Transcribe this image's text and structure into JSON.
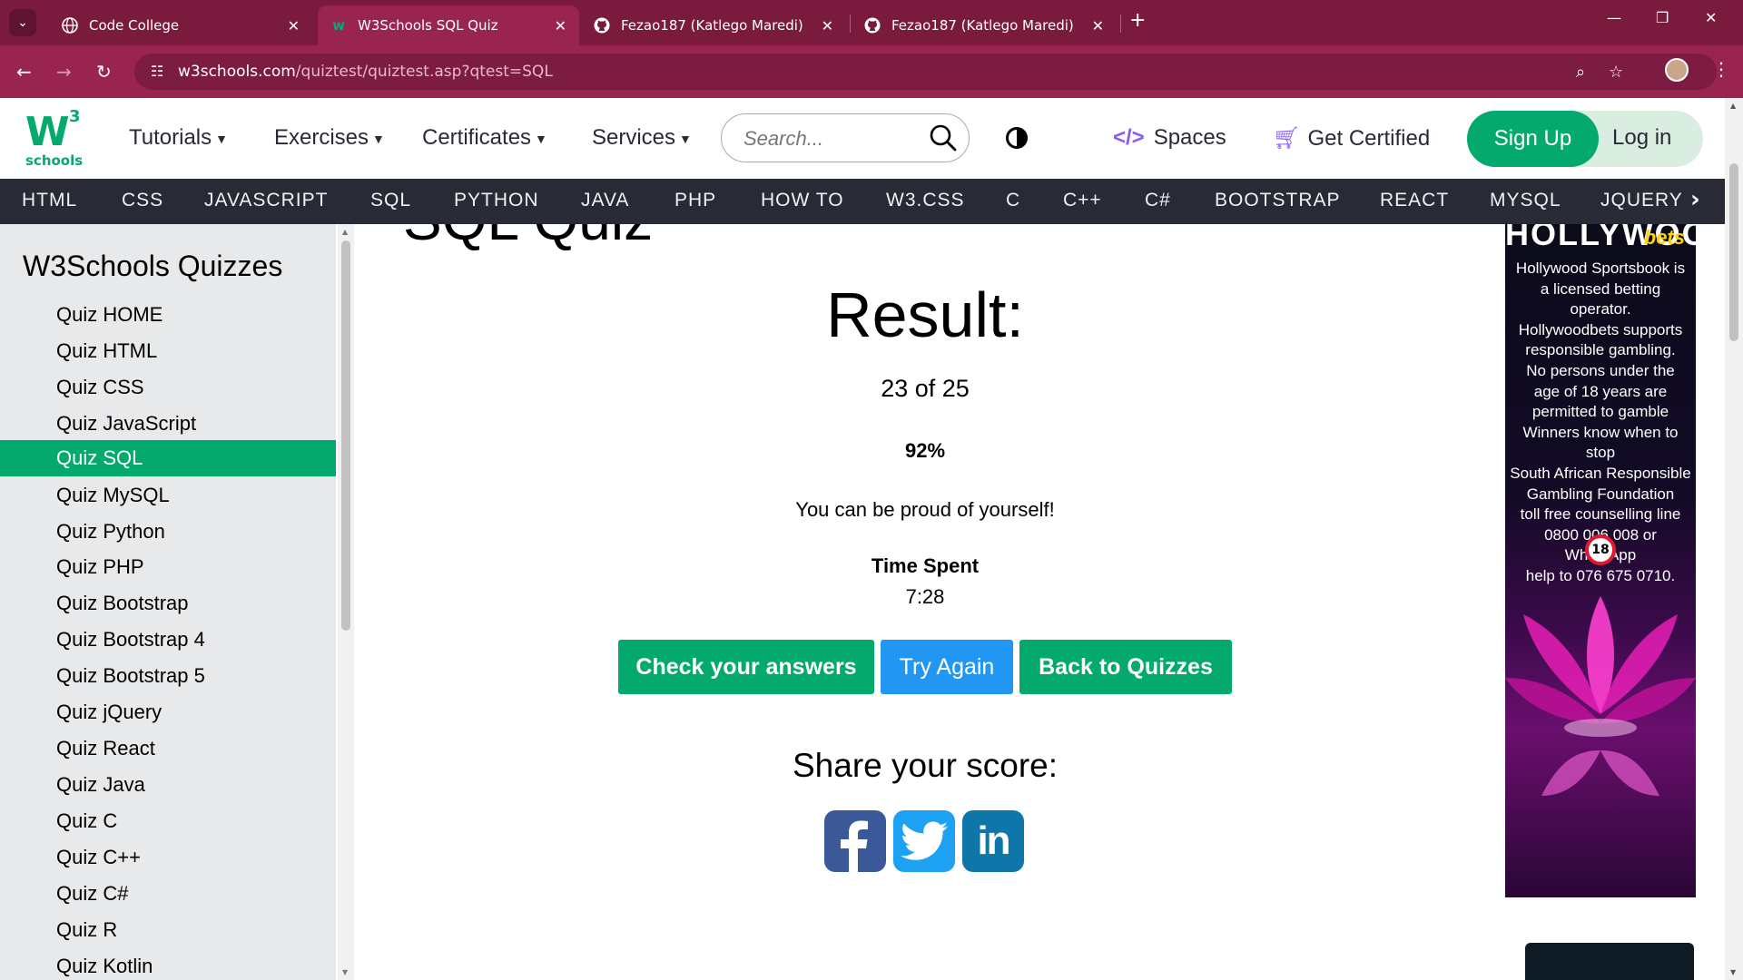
{
  "browser": {
    "tabs": [
      {
        "title": "Code College",
        "active": false
      },
      {
        "title": "W3Schools SQL Quiz",
        "active": true
      },
      {
        "title": "Fezao187 (Katlego Maredi)",
        "active": false
      },
      {
        "title": "Fezao187 (Katlego Maredi)",
        "active": false
      }
    ],
    "url_host": "w3schools.com",
    "url_path": "/quiztest/quiztest.asp?qtest=SQL"
  },
  "topnav": {
    "logo_number": "3",
    "logo_text": "schools",
    "menus": [
      "Tutorials",
      "Exercises",
      "Certificates",
      "Services"
    ],
    "search_placeholder": "Search...",
    "spaces": "Spaces",
    "get_certified": "Get Certified",
    "sign_up": "Sign Up",
    "log_in": "Log in"
  },
  "subjects": [
    "HTML",
    "CSS",
    "JAVASCRIPT",
    "SQL",
    "PYTHON",
    "JAVA",
    "PHP",
    "HOW TO",
    "W3.CSS",
    "C",
    "C++",
    "C#",
    "BOOTSTRAP",
    "REACT",
    "MYSQL",
    "JQUERY"
  ],
  "sidebar": {
    "title": "W3Schools Quizzes",
    "items": [
      "Quiz HOME",
      "Quiz HTML",
      "Quiz CSS",
      "Quiz JavaScript",
      "Quiz SQL",
      "Quiz MySQL",
      "Quiz Python",
      "Quiz PHP",
      "Quiz Bootstrap",
      "Quiz Bootstrap 4",
      "Quiz Bootstrap 5",
      "Quiz jQuery",
      "Quiz React",
      "Quiz Java",
      "Quiz C",
      "Quiz C++",
      "Quiz C#",
      "Quiz R",
      "Quiz Kotlin"
    ],
    "active_item": "Quiz SQL"
  },
  "main": {
    "page_title": "SQL Quiz",
    "result_heading": "Result:",
    "score": "23 of 25",
    "percent": "92%",
    "message": "You can be proud of yourself!",
    "time_label": "Time Spent",
    "time_value": "7:28",
    "buttons": {
      "check": "Check your answers",
      "try_again": "Try Again",
      "back": "Back to Quizzes"
    },
    "share_heading": "Share your score:",
    "social": [
      "facebook-icon",
      "twitter-icon",
      "linkedin-icon"
    ]
  },
  "ad": {
    "brand": "HOLLYWOOD",
    "brand_suffix": "bets",
    "lines": [
      "Hollywood Sportsbook is",
      "a licensed betting operator.",
      "Hollywoodbets supports",
      "responsible gambling.",
      "No persons under the",
      "age of 18 years are",
      "permitted to gamble",
      "Winners know when to stop",
      "South African Responsible",
      "Gambling Foundation",
      "toll free counselling line",
      "0800 006 008 or WhatsApp",
      "help to 076 675 0710."
    ],
    "age_badge": "18"
  },
  "colors": {
    "w3_green": "#04aa6d",
    "w3_dark": "#282a35",
    "sidebar_bg": "#e7e9eb",
    "try_again_blue": "#2196f3",
    "browser_frame": "#9a2450"
  }
}
